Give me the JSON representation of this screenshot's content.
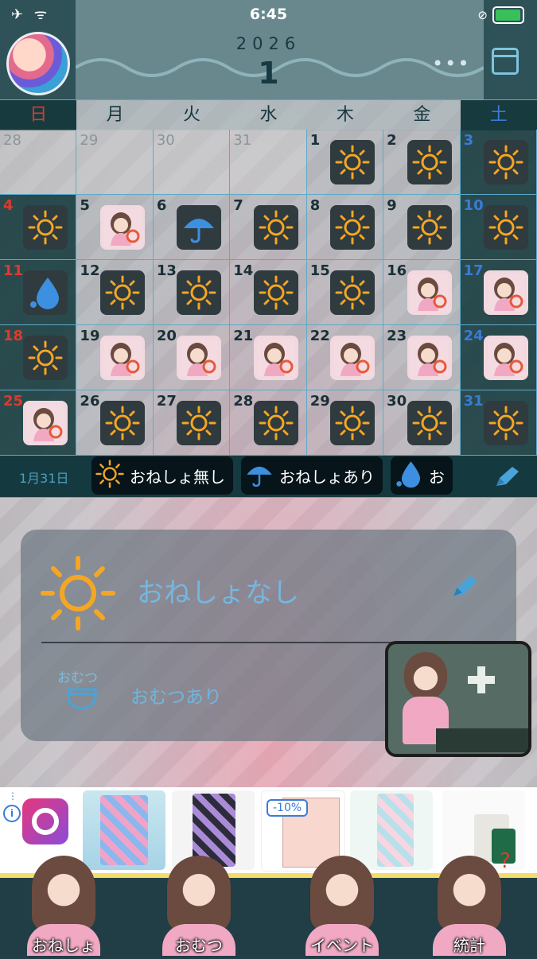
{
  "status_bar": {
    "time": "6:45",
    "left_icons": [
      "airplane-icon",
      "wifi-icon"
    ],
    "right_icons": [
      "lock-rotation-icon",
      "battery-charging-icon"
    ]
  },
  "header": {
    "year": "2026",
    "month": "1",
    "more_label": "•••"
  },
  "weekdays": [
    "日",
    "月",
    "火",
    "水",
    "木",
    "金",
    "土"
  ],
  "calendar": {
    "weeks": [
      [
        {
          "d": "28",
          "out": true,
          "icon": ""
        },
        {
          "d": "29",
          "out": true,
          "icon": ""
        },
        {
          "d": "30",
          "out": true,
          "icon": ""
        },
        {
          "d": "31",
          "out": true,
          "icon": ""
        },
        {
          "d": "1",
          "icon": "sun"
        },
        {
          "d": "2",
          "icon": "sun"
        },
        {
          "d": "3",
          "icon": "sun"
        }
      ],
      [
        {
          "d": "4",
          "icon": "sun"
        },
        {
          "d": "5",
          "icon": "girl"
        },
        {
          "d": "6",
          "icon": "umbrella"
        },
        {
          "d": "7",
          "icon": "sun"
        },
        {
          "d": "8",
          "icon": "sun"
        },
        {
          "d": "9",
          "icon": "sun"
        },
        {
          "d": "10",
          "icon": "sun"
        }
      ],
      [
        {
          "d": "11",
          "icon": "drop"
        },
        {
          "d": "12",
          "icon": "sun"
        },
        {
          "d": "13",
          "icon": "sun"
        },
        {
          "d": "14",
          "icon": "sun"
        },
        {
          "d": "15",
          "icon": "sun"
        },
        {
          "d": "16",
          "icon": "girl"
        },
        {
          "d": "17",
          "icon": "girl"
        }
      ],
      [
        {
          "d": "18",
          "icon": "sun"
        },
        {
          "d": "19",
          "icon": "girl"
        },
        {
          "d": "20",
          "icon": "girl"
        },
        {
          "d": "21",
          "icon": "girl"
        },
        {
          "d": "22",
          "icon": "girl"
        },
        {
          "d": "23",
          "icon": "girl"
        },
        {
          "d": "24",
          "icon": "girl"
        }
      ],
      [
        {
          "d": "25",
          "icon": "girl"
        },
        {
          "d": "26",
          "icon": "sun"
        },
        {
          "d": "27",
          "icon": "sun"
        },
        {
          "d": "28",
          "icon": "sun"
        },
        {
          "d": "29",
          "icon": "sun"
        },
        {
          "d": "30",
          "icon": "sun"
        },
        {
          "d": "31",
          "icon": "sun"
        }
      ]
    ]
  },
  "legend": {
    "selected_date": "1月31日",
    "chips": [
      {
        "icon": "sun",
        "label": "おねしょ無し"
      },
      {
        "icon": "umbrella",
        "label": "おねしょあり"
      },
      {
        "icon": "drop",
        "label": "お"
      }
    ]
  },
  "detail": {
    "status": "おねしょなし",
    "diaper_label": "おむつ",
    "diaper_value": "おむつあり"
  },
  "ads": {
    "discount": "-10%"
  },
  "tabs": [
    "おねしょ",
    "おむつ",
    "イベント",
    "統計"
  ],
  "colors": {
    "sun": "#f5a623",
    "blue": "#3d8fe0",
    "accent_line": "#5ea9c7",
    "sunday": "#e0392b",
    "saturday": "#3a7bd8"
  }
}
